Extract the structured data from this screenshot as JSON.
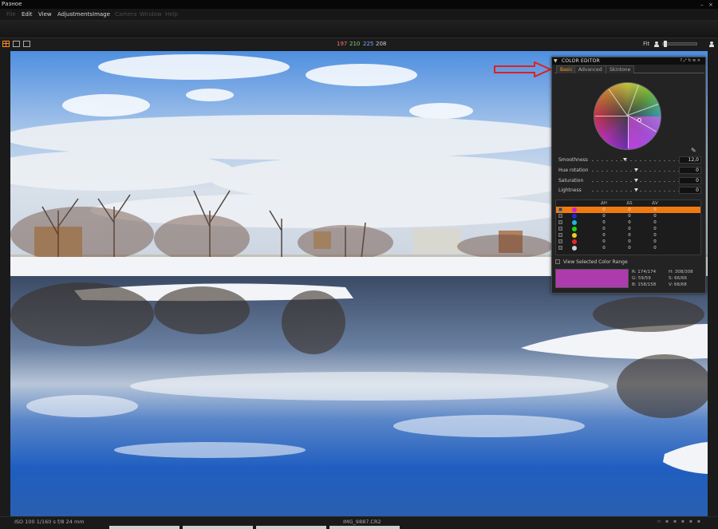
{
  "app": {
    "title": "Разное"
  },
  "menu": [
    "File",
    "Edit",
    "View",
    "Adjustments",
    "Image",
    "Camera",
    "Window",
    "Help"
  ],
  "toolbar": {
    "rgb": {
      "r": "197",
      "g": "210",
      "b": "225",
      "l": "208"
    },
    "fit_label": "Fit"
  },
  "status": {
    "exif": "ISO 100  1/160 s  f/8  24 mm",
    "filename": "IMG_9887.CR2"
  },
  "color_editor": {
    "title": "COLOR EDITOR",
    "header_controls": "? ⤢ ↻ ≡ ×",
    "tabs": [
      "Basic",
      "Advanced",
      "Skintone"
    ],
    "active_tab": "Basic",
    "sliders": [
      {
        "label": "Smoothness",
        "value": "12,0"
      },
      {
        "label": "Hue rotation",
        "value": "0"
      },
      {
        "label": "Saturation",
        "value": "0"
      },
      {
        "label": "Lightness",
        "value": "0"
      }
    ],
    "table": {
      "headers": [
        "ΔH",
        "ΔS",
        "ΔV"
      ],
      "rows": [
        {
          "color": "#d21fd2",
          "dh": "0",
          "ds": "0",
          "dv": "0",
          "selected": true
        },
        {
          "color": "#1a28d8",
          "dh": "0",
          "ds": "0",
          "dv": "0"
        },
        {
          "color": "#22b8d8",
          "dh": "0",
          "ds": "0",
          "dv": "0"
        },
        {
          "color": "#1ed21e",
          "dh": "0",
          "ds": "0",
          "dv": "0"
        },
        {
          "color": "#e8d21a",
          "dh": "0",
          "ds": "0",
          "dv": "0"
        },
        {
          "color": "#e02828",
          "dh": "0",
          "ds": "0",
          "dv": "0"
        },
        {
          "color": "#cfcfcf",
          "dh": "0",
          "ds": "0",
          "dv": "0"
        }
      ]
    },
    "view_range_label": "View Selected Color Range",
    "readout": {
      "r": "R:",
      "r_val": "174/174",
      "g": "G:",
      "g_val": "59/59",
      "b": "B:",
      "b_val": "158/158",
      "h": "H:",
      "h_val": "308/308",
      "s": "S:",
      "s_val": "66/66",
      "v": "V:",
      "v_val": "68/68"
    },
    "swatch_color": "#ae3bae"
  },
  "colors": {
    "accent": "#f07a12",
    "annotation_arrow": "#e02020"
  }
}
